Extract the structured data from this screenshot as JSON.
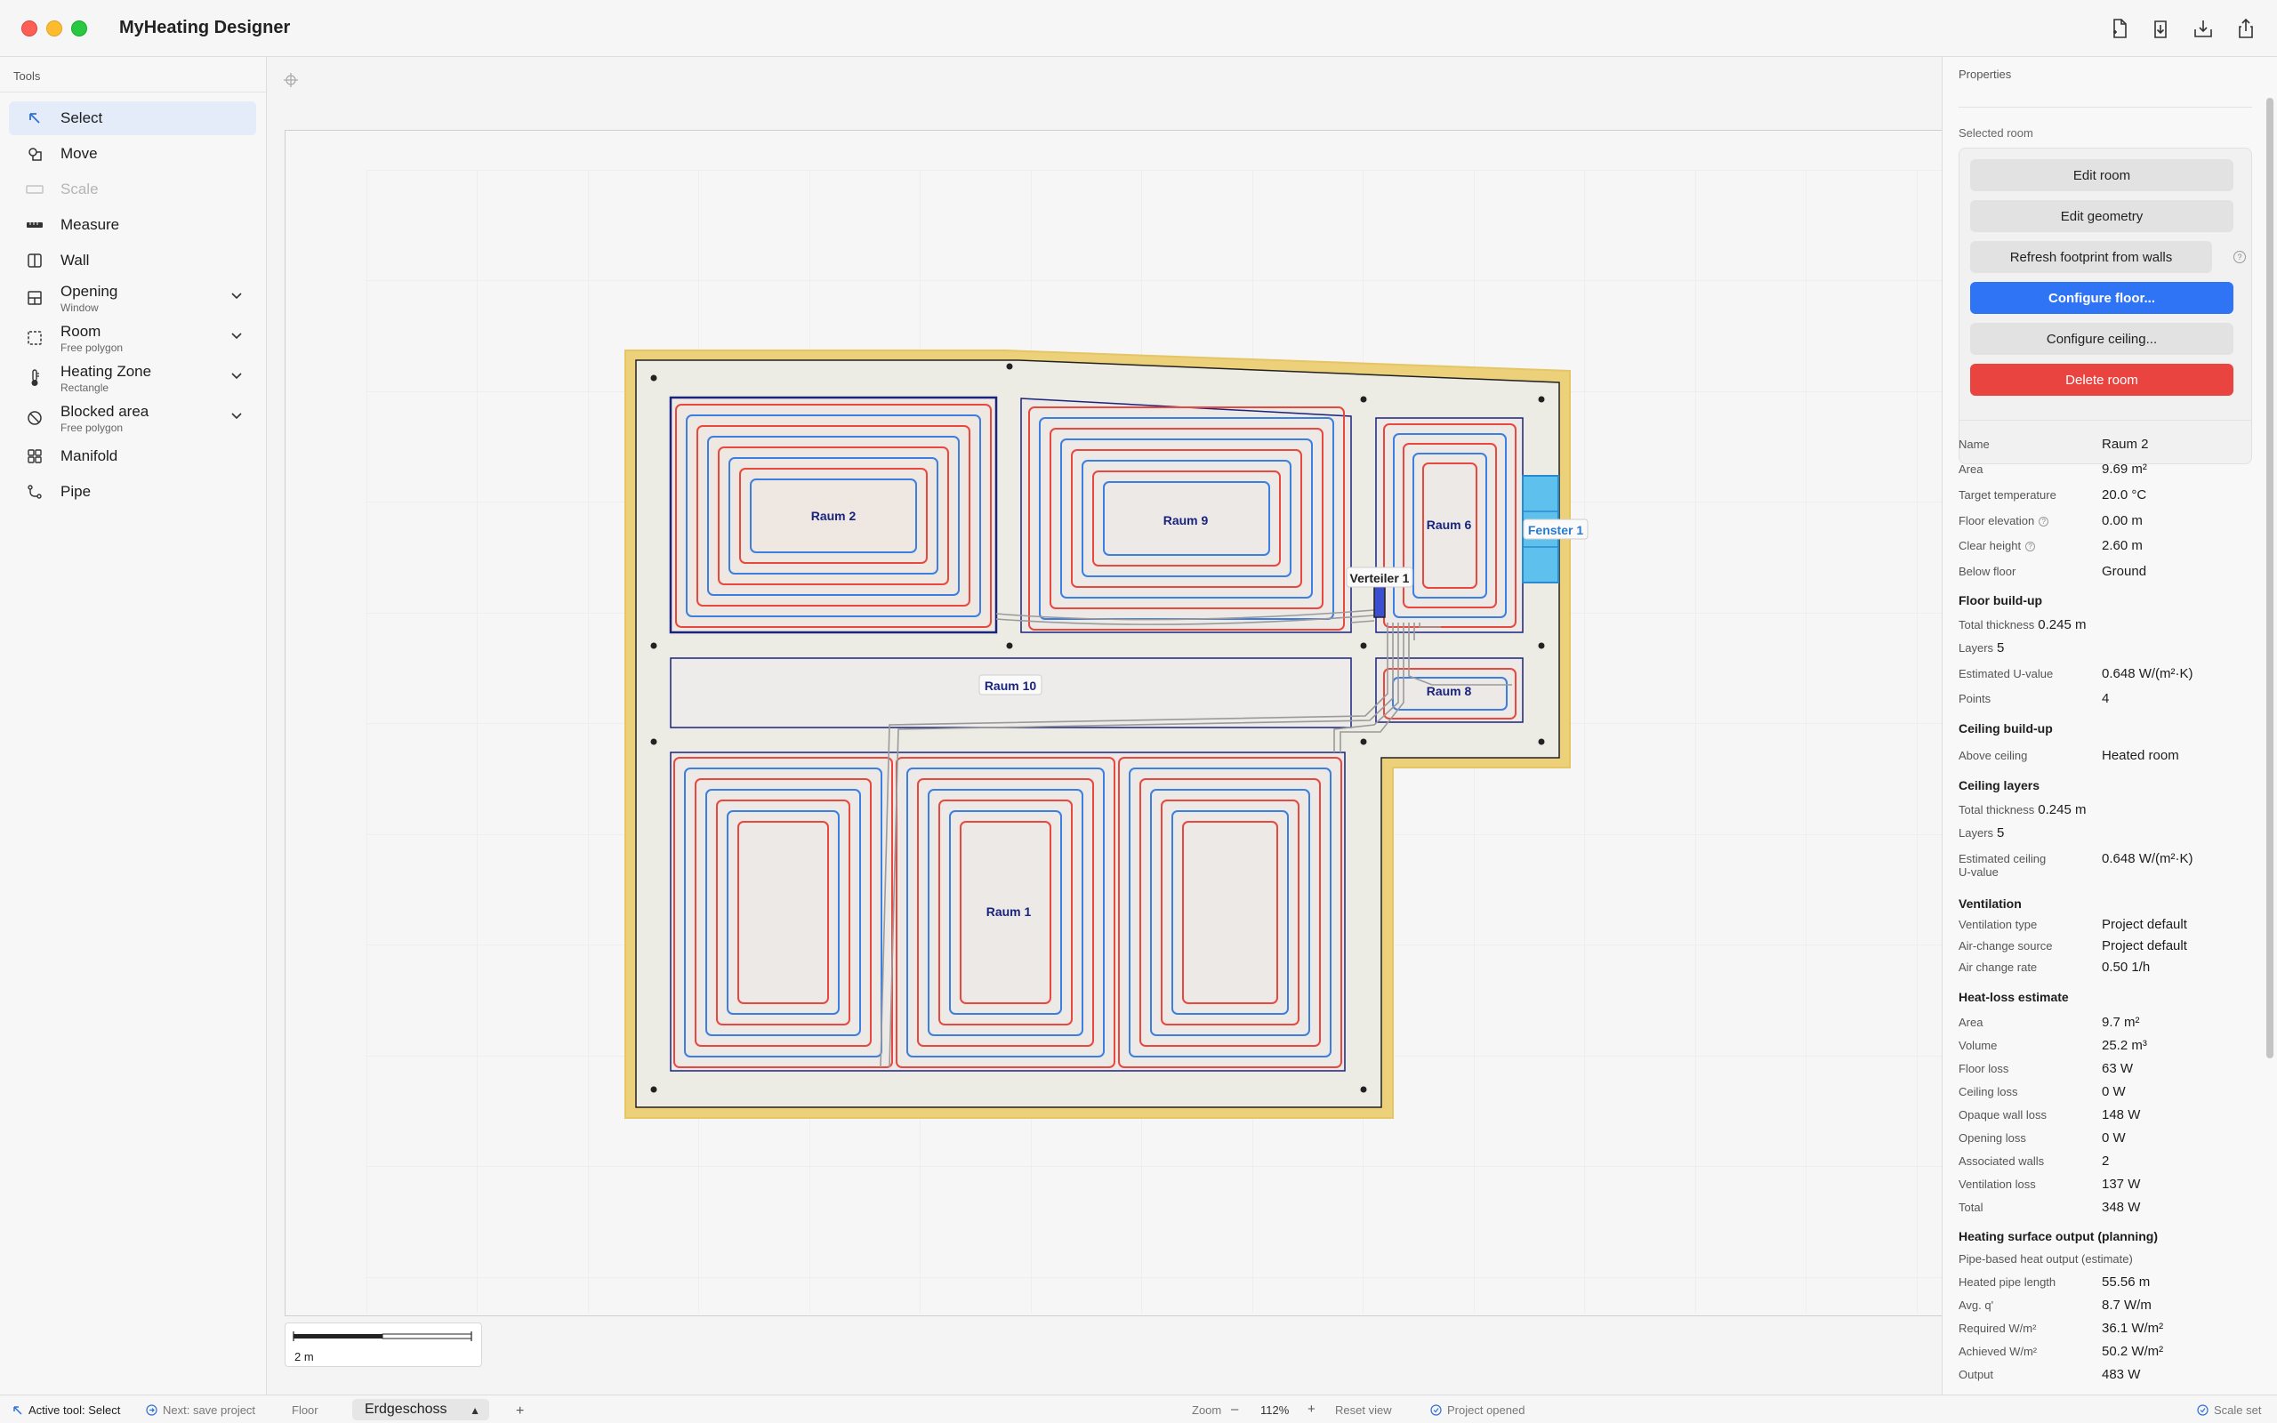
{
  "window": {
    "title": "MyHeating Designer"
  },
  "toolbar_icons": [
    "new-file-icon",
    "import-icon",
    "download-icon",
    "share-icon"
  ],
  "sidebar": {
    "header": "Tools",
    "tools": [
      {
        "label": "Select",
        "icon": "cursor-arrow-icon",
        "active": true
      },
      {
        "label": "Move",
        "icon": "move-icon"
      },
      {
        "label": "Scale",
        "icon": "scale-icon",
        "disabled": true
      },
      {
        "label": "Measure",
        "icon": "ruler-icon"
      },
      {
        "label": "Wall",
        "icon": "wall-icon"
      },
      {
        "label": "Opening",
        "sub": "Window",
        "icon": "opening-icon",
        "dropdown": true
      },
      {
        "label": "Room",
        "sub": "Free polygon",
        "icon": "room-icon",
        "dropdown": true
      },
      {
        "label": "Heating Zone",
        "sub": "Rectangle",
        "icon": "thermometer-icon",
        "dropdown": true
      },
      {
        "label": "Blocked area",
        "sub": "Free polygon",
        "icon": "blocked-icon",
        "dropdown": true
      },
      {
        "label": "Manifold",
        "icon": "manifold-icon"
      },
      {
        "label": "Pipe",
        "icon": "pipe-icon"
      }
    ]
  },
  "plan": {
    "labels": {
      "raum2": "Raum 2",
      "raum9": "Raum 9",
      "raum6": "Raum 6",
      "raum10": "Raum 10",
      "raum8": "Raum 8",
      "raum1": "Raum 1",
      "verteiler": "Verteiler 1",
      "fenster": "Fenster 1"
    },
    "scale_label": "2 m",
    "colors": {
      "wall": "#ecd07a",
      "supply": "#e8483d",
      "return": "#3b7fe0",
      "room_border": "#1a237e",
      "window": "#5ec0ec"
    }
  },
  "properties": {
    "header": "Properties",
    "selected_label": "Selected room",
    "buttons": {
      "edit_room": "Edit room",
      "edit_geometry": "Edit geometry",
      "refresh_footprint": "Refresh footprint from walls",
      "configure_floor": "Configure floor...",
      "configure_ceiling": "Configure ceiling...",
      "delete_room": "Delete room"
    },
    "general": [
      {
        "label": "Name",
        "value": "Raum 2"
      },
      {
        "label": "Area",
        "value": "9.69 m²"
      },
      {
        "label": "Target temperature",
        "value": "20.0 °C"
      },
      {
        "label": "Floor elevation",
        "value": "0.00 m",
        "info": true
      },
      {
        "label": "Clear height",
        "value": "2.60 m",
        "info": true
      },
      {
        "label": "Below floor",
        "value": "Ground"
      }
    ],
    "floor_buildup": {
      "title": "Floor build-up",
      "total_label": "Total thickness",
      "total_value": "0.245 m",
      "layers_label": "Layers",
      "layers_value": "5",
      "u_label": "Estimated U-value",
      "u_value": "0.648 W/(m²·K)",
      "points_label": "Points",
      "points_value": "4"
    },
    "ceiling_buildup": {
      "title": "Ceiling build-up",
      "above_label": "Above ceiling",
      "above_value": "Heated room"
    },
    "ceiling_layers": {
      "title": "Ceiling layers",
      "total_label": "Total thickness",
      "total_value": "0.245 m",
      "layers_label": "Layers",
      "layers_value": "5",
      "u_label_1": "Estimated ceiling",
      "u_label_2": "U-value",
      "u_value": "0.648 W/(m²·K)"
    },
    "ventilation": {
      "title": "Ventilation",
      "rows": [
        {
          "label": "Ventilation type",
          "value": "Project default"
        },
        {
          "label": "Air-change source",
          "value": "Project default"
        },
        {
          "label": "Air change rate",
          "value": "0.50 1/h"
        }
      ]
    },
    "heat_loss": {
      "title": "Heat-loss estimate",
      "rows": [
        {
          "label": "Area",
          "value": "9.7 m²"
        },
        {
          "label": "Volume",
          "value": "25.2 m³"
        },
        {
          "label": "Floor loss",
          "value": "63 W"
        },
        {
          "label": "Ceiling loss",
          "value": "0 W"
        },
        {
          "label": "Opaque wall loss",
          "value": "148 W"
        },
        {
          "label": "Opening loss",
          "value": "0 W"
        },
        {
          "label": "Associated walls",
          "value": "2"
        },
        {
          "label": "Ventilation loss",
          "value": "137 W"
        },
        {
          "label": "Total",
          "value": "348 W"
        }
      ]
    },
    "heating_output": {
      "title": "Heating surface output (planning)",
      "subtitle": "Pipe-based heat output (estimate)",
      "rows": [
        {
          "label": "Heated pipe length",
          "value": "55.56 m"
        },
        {
          "label": "Avg. q'",
          "value": "8.7 W/m"
        },
        {
          "label": "Required W/m²",
          "value": "36.1 W/m²"
        },
        {
          "label": "Achieved W/m²",
          "value": "50.2 W/m²"
        },
        {
          "label": "Output",
          "value": "483 W"
        }
      ]
    }
  },
  "status": {
    "active_tool": "Active tool: Select",
    "next": "Next: save project",
    "floor_label": "Floor",
    "floor_value": "Erdgeschoss",
    "add": "+",
    "zoom_label": "Zoom",
    "zoom_minus": "–",
    "zoom_value": "112%",
    "zoom_plus": "+",
    "reset_view": "Reset view",
    "project_status": "Project opened",
    "scale_status": "Scale set"
  }
}
